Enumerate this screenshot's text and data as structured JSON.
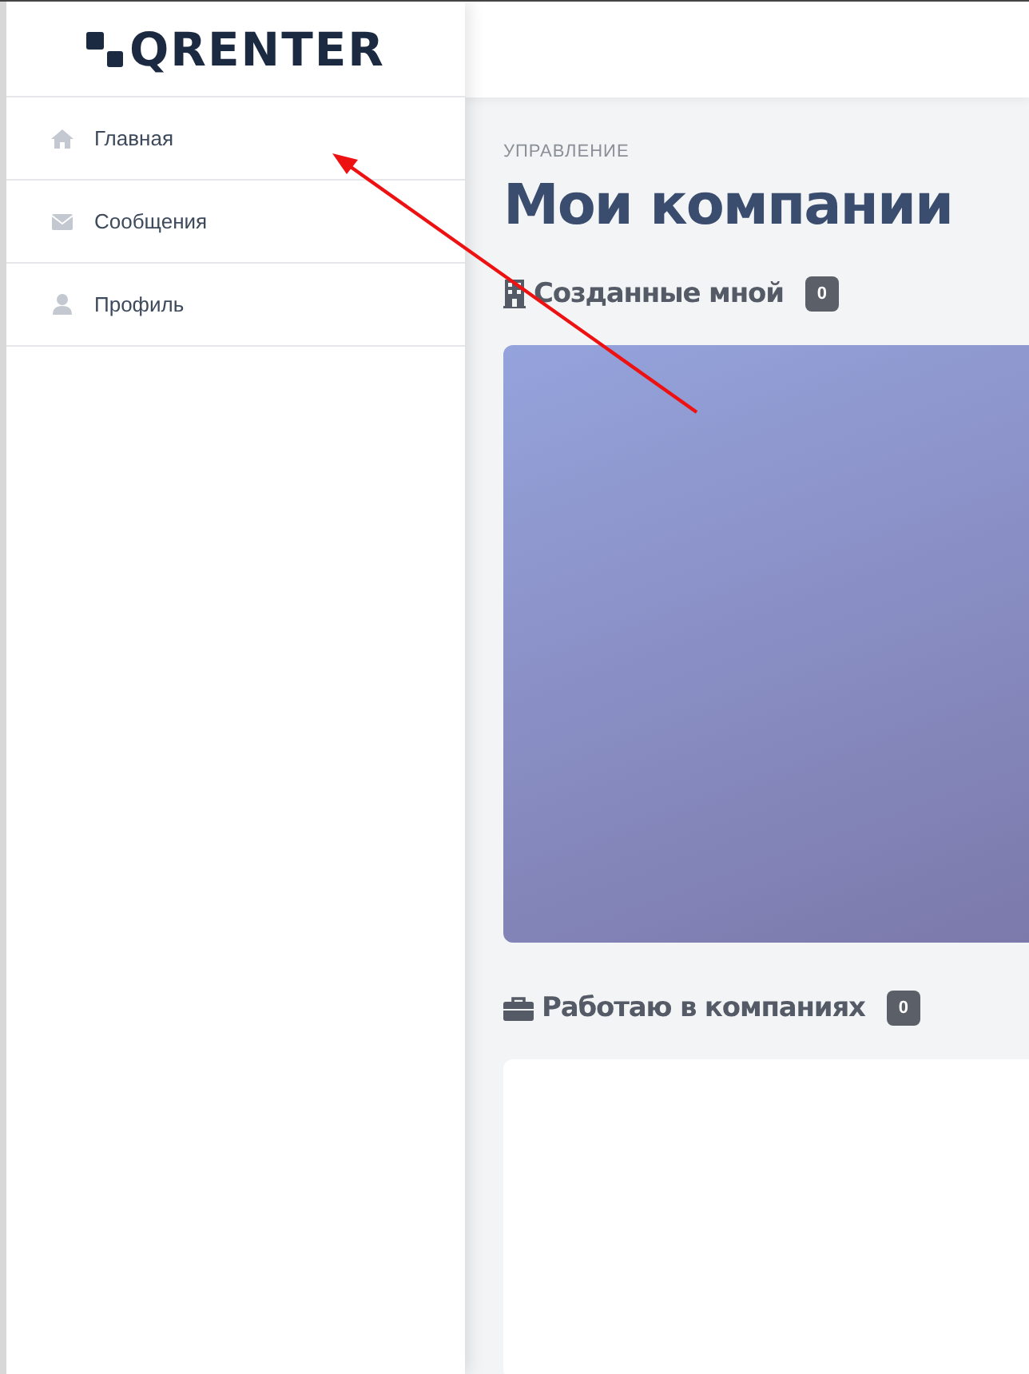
{
  "logo": {
    "text": "QRENTER"
  },
  "sidebar": {
    "items": [
      {
        "label": "Главная",
        "kind": "home",
        "selected": false
      },
      {
        "label": "Сообщения",
        "kind": "mail",
        "selected": false
      },
      {
        "label": "Профиль",
        "kind": "user",
        "selected": false
      }
    ]
  },
  "main": {
    "breadcrumb": "УПРАВЛЕНИЕ",
    "title": "Мои компании",
    "sections": [
      {
        "title": "Созданные мной",
        "kind": "building",
        "count": "0"
      },
      {
        "title": "Работаю в компаниях",
        "kind": "briefcase",
        "count": "0"
      }
    ]
  }
}
